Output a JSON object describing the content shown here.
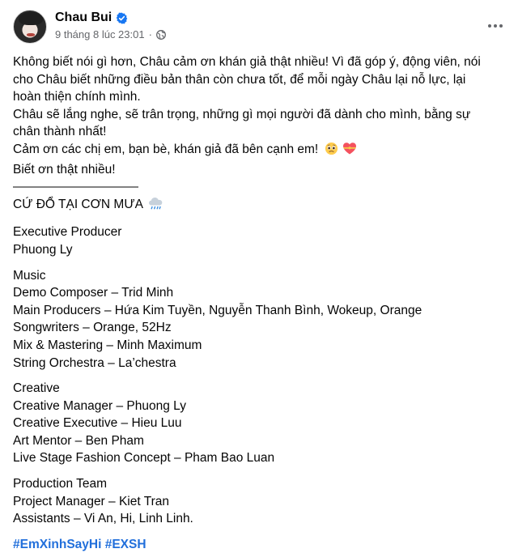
{
  "post": {
    "author": "Chau Bui",
    "timestamp": "9 tháng 8 lúc 23:01",
    "dot": "·",
    "icons": {
      "verified": "verified-badge-icon",
      "privacy": "globe-icon",
      "more": "more-options-icon",
      "cloud": "rain-cloud-icon",
      "sad_face": "pleading-face-icon",
      "heart": "heart-with-ribbon-icon"
    },
    "colors": {
      "name": "#050505",
      "meta": "#65676b",
      "verified": "#1877f2",
      "hashtag": "#216fdb"
    },
    "intro_lines": [
      "Không biết nói gì hơn, Châu cảm ơn khán giả thật nhiều! Vì đã góp ý, động viên, nói",
      "cho Châu biết những điều bản thân còn chưa tốt, để mỗi ngày Châu lại nỗ lực, lại",
      "hoàn thiện chính mình.",
      "Châu sẽ lắng nghe, sẽ trân trọng, những gì mọi người đã dành cho mình, bằng sự",
      "chân thành nhất!",
      "Cảm ơn các chị em, bạn bè, khán giả đã bên cạnh em!",
      "Biết ơn thật nhiều!"
    ],
    "separator": "———————————",
    "song_title": "CỨ ĐỔ TẠI CƠN MƯA",
    "sections": [
      {
        "lines": [
          "Executive Producer",
          "Phuong Ly"
        ]
      },
      {
        "lines": [
          "Music",
          "Demo Composer – Trid Minh",
          "Main Producers – Hứa Kim Tuyền, Nguyễn Thanh Bình, Wokeup, Orange",
          "Songwriters – Orange, 52Hz",
          "Mix & Mastering – Minh Maximum",
          "String Orchestra – La’chestra"
        ]
      },
      {
        "lines": [
          "Creative",
          "Creative Manager – Phuong Ly",
          "Creative Executive – Hieu Luu",
          "Art Mentor – Ben Pham",
          "Live Stage Fashion Concept – Pham Bao Luan"
        ]
      },
      {
        "lines": [
          "Production Team",
          "Project Manager – Kiet Tran",
          "Assistants – Vi An, Hi, Linh Linh."
        ]
      }
    ],
    "hashtags": [
      "#EmXinhSayHi",
      "#EXSH"
    ]
  }
}
